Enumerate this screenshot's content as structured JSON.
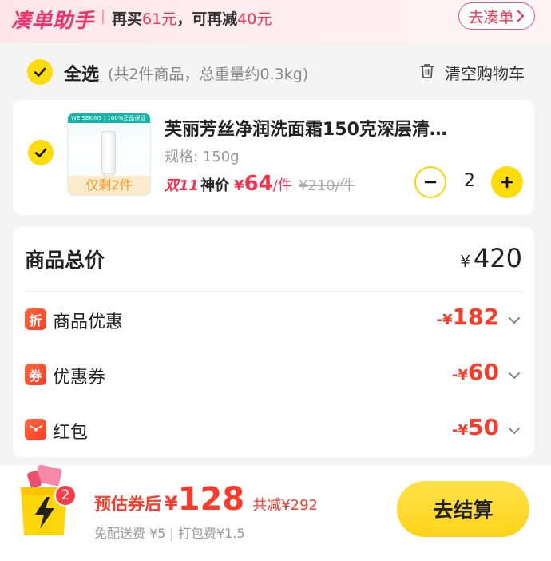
{
  "promo": {
    "logo": "凑单助手",
    "msg_prefix": "再买",
    "msg_amount1": "61元",
    "msg_middle": "，可再减",
    "msg_amount2": "40元",
    "button_label": "去凑单",
    "button_icon": "chevron-right-icon"
  },
  "select_all": {
    "checked": true,
    "label": "全选",
    "summary": "(共2件商品，总重量约0.3kg)",
    "clear_label": "清空购物车",
    "clear_icon": "trash-icon"
  },
  "product": {
    "checked": true,
    "thumb_brand_band": "WEISEKINS | 100%正品保证",
    "stock_tag": "仅剩2件",
    "name": "芙丽芳丝净润洗面霜150克深层清…",
    "spec": "规格: 150g",
    "promo_tag": "双11",
    "promo_price_label": "神价",
    "currency": "¥",
    "price": "64",
    "unit": "/件",
    "original_price": "¥210/件",
    "quantity": "2"
  },
  "summary": {
    "title": "商品总价",
    "currency": "¥",
    "total": "420",
    "discounts": [
      {
        "icon_char": "折",
        "label": "商品优惠",
        "sign": "-",
        "currency": "¥",
        "amount": "182"
      },
      {
        "icon_char": "券",
        "label": "优惠券",
        "sign": "-",
        "currency": "¥",
        "amount": "60"
      },
      {
        "icon_char": "",
        "label": "红包",
        "sign": "-",
        "currency": "¥",
        "amount": "50"
      }
    ]
  },
  "bottom": {
    "cart_badge": "2",
    "estimate_label": "预估券后",
    "currency": "¥",
    "estimate_amount": "128",
    "total_saving": "共减¥292",
    "fees": "免配送费 ¥5 | 打包费¥1.5",
    "checkout_label": "去结算"
  },
  "colors": {
    "accent_yellow": "#ffdc0a",
    "price_red": "#ff2e4e",
    "promo_pink": "#f2306b"
  }
}
